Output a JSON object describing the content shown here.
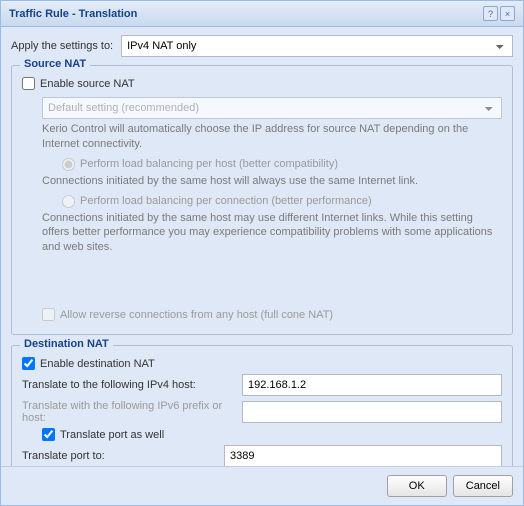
{
  "window": {
    "title": "Traffic Rule - Translation",
    "help_icon": "?",
    "close_icon": "×"
  },
  "apply": {
    "label": "Apply the settings to:",
    "value": "IPv4 NAT only"
  },
  "sourceNat": {
    "legend": "Source NAT",
    "enable_label": "Enable source NAT",
    "enabled": false,
    "mode_value": "Default setting (recommended)",
    "mode_help": "Kerio Control will automatically choose the IP address for source NAT depending on the Internet connectivity.",
    "lb_host_label": "Perform load balancing per host (better compatibility)",
    "lb_host_help": "Connections initiated by the same host will always use the same Internet link.",
    "lb_conn_label": "Perform load balancing per connection (better performance)",
    "lb_conn_help": "Connections initiated by the same host may use different Internet links. While this setting offers better performance you may experience compatibility problems with some applications and web sites.",
    "full_cone_label": "Allow reverse connections from any host (full cone NAT)"
  },
  "destNat": {
    "legend": "Destination NAT",
    "enable_label": "Enable destination NAT",
    "enabled": true,
    "ipv4_label": "Translate to the following IPv4 host:",
    "ipv4_value": "192.168.1.2",
    "ipv6_label": "Translate with the following IPv6 prefix or host:",
    "ipv6_value": "",
    "port_checkbox_label": "Translate port as well",
    "port_checked": true,
    "port_label": "Translate port to:",
    "port_value": "3389"
  },
  "footer": {
    "ok": "OK",
    "cancel": "Cancel"
  }
}
